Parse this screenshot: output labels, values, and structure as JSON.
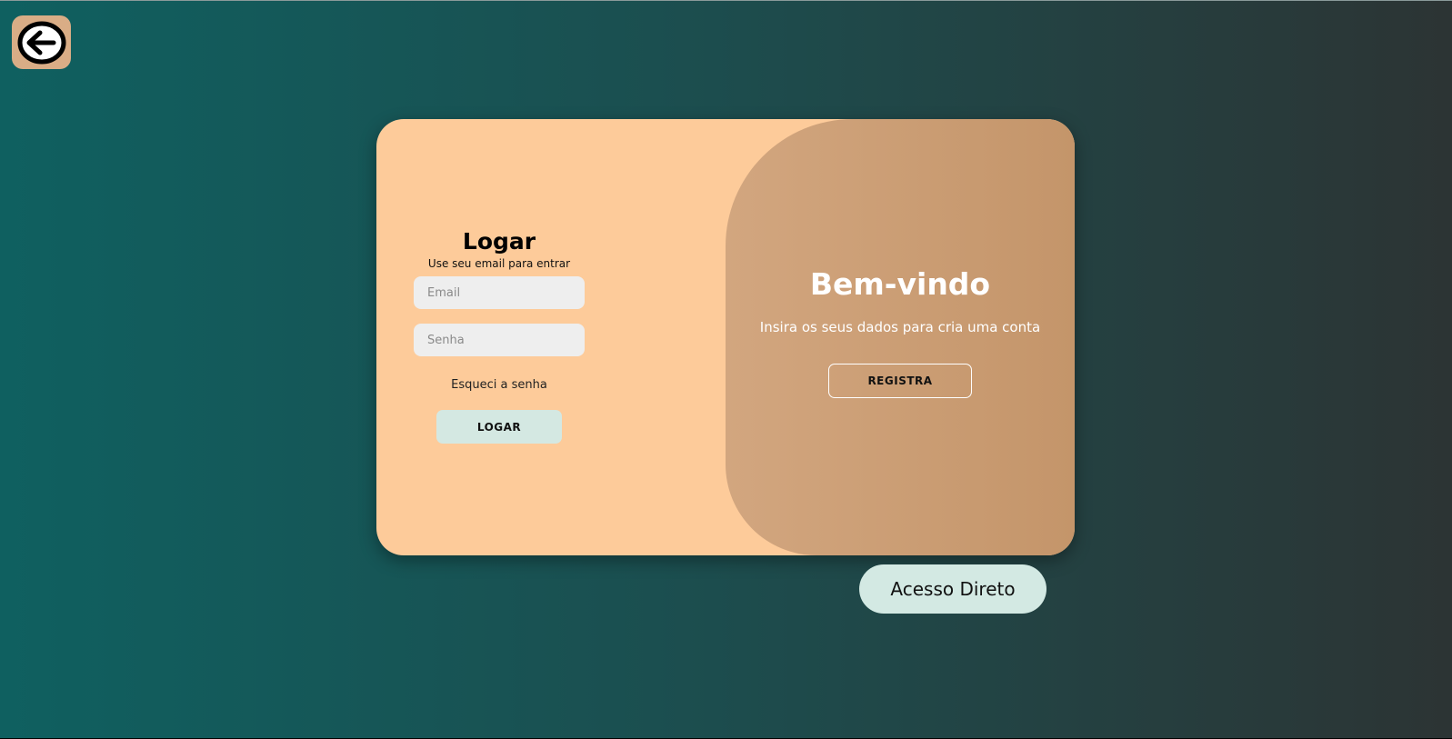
{
  "back": {
    "icon": "arrow-left-circle-icon"
  },
  "login": {
    "title": "Logar",
    "subtitle": "Use seu email para entrar",
    "email_placeholder": "Email",
    "password_placeholder": "Senha",
    "forgot_label": "Esqueci a senha",
    "submit_label": "LOGAR"
  },
  "welcome": {
    "title": "Bem-vindo",
    "subtitle": "Insira os seus dados para cria uma conta",
    "register_label": "REGISTRA"
  },
  "direct_access_label": "Acesso Direto",
  "colors": {
    "card": "#fdcb9a",
    "welcome_panel": "#c99b72",
    "button_mint": "#d4e8e2",
    "back_button": "#d9ad86"
  }
}
